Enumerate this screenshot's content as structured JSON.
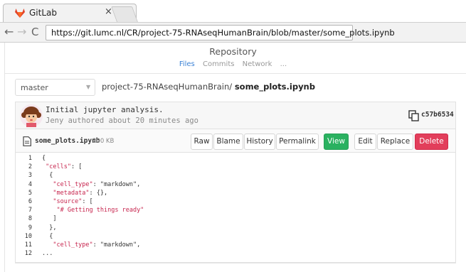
{
  "browser": {
    "tab_title": "GitLab",
    "tab_close": "×",
    "url": "https://git.lumc.nl/CR/project-75-RNAseqHumanBrain/blob/master/some_plots.ipynb",
    "back": "←",
    "forward": "→",
    "reload": "C"
  },
  "header": {
    "title": "Repository",
    "subnav": [
      "Files",
      "Commits",
      "Network",
      "..."
    ]
  },
  "branch": {
    "name": "master"
  },
  "breadcrumb": {
    "path": "project-75-RNAseqHumanBrain/ ",
    "file": "some_plots.ipynb"
  },
  "commit": {
    "message": "Initial jupyter analysis.",
    "meta": "Jeny authored about 20 minutes ago",
    "sha": "c57b6534"
  },
  "file": {
    "name": "some_plots.ipynb",
    "size": "200 KB",
    "buttons": {
      "raw": "Raw",
      "blame": "Blame",
      "history": "History",
      "permalink": "Permalink",
      "view": "View",
      "edit": "Edit",
      "replace": "Replace",
      "delete": "Delete"
    }
  },
  "colors": {
    "view_button": "#2ab160",
    "delete_button": "#e23e5b",
    "active_tab": "#3b82d6",
    "json_key": "#c7254e"
  },
  "code": {
    "lines": [
      {
        "n": "1",
        "pre": "{",
        "key": "",
        "post": ""
      },
      {
        "n": "2",
        "pre": " ",
        "key": "\"cells\"",
        "post": ": ["
      },
      {
        "n": "3",
        "pre": "  {",
        "key": "",
        "post": ""
      },
      {
        "n": "4",
        "pre": "   ",
        "key": "\"cell_type\"",
        "post": ": \"markdown\","
      },
      {
        "n": "5",
        "pre": "   ",
        "key": "\"metadata\"",
        "post": ": {},"
      },
      {
        "n": "6",
        "pre": "   ",
        "key": "\"source\"",
        "post": ": ["
      },
      {
        "n": "7",
        "pre": "    ",
        "key": "\"# Getting things ready\"",
        "post": ""
      },
      {
        "n": "8",
        "pre": "   ]",
        "key": "",
        "post": ""
      },
      {
        "n": "9",
        "pre": "  },",
        "key": "",
        "post": ""
      },
      {
        "n": "10",
        "pre": "  {",
        "key": "",
        "post": ""
      },
      {
        "n": "11",
        "pre": "   ",
        "key": "\"cell_type\"",
        "post": ": \"markdown\","
      },
      {
        "n": "12",
        "pre": "...",
        "key": "",
        "post": ""
      }
    ]
  }
}
